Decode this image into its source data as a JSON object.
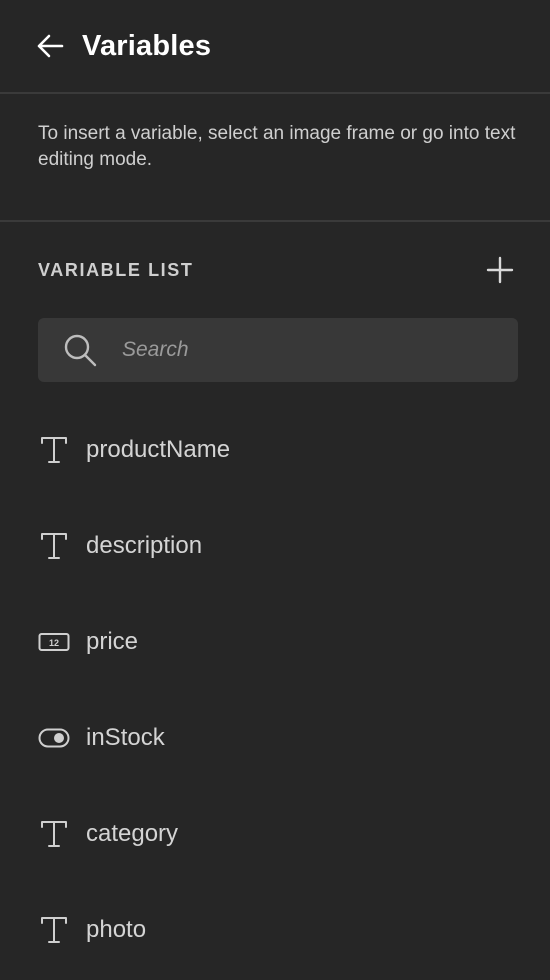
{
  "header": {
    "title": "Variables",
    "back_icon": "arrow-left-icon"
  },
  "hint": {
    "text": "To insert a variable, select an image frame or go into text editing mode."
  },
  "variable_list": {
    "title": "VARIABLE LIST",
    "add_icon": "plus-icon",
    "search": {
      "placeholder": "Search",
      "value": ""
    },
    "items": [
      {
        "label": "productName",
        "type": "text",
        "icon": "text-type-icon"
      },
      {
        "label": "description",
        "type": "text",
        "icon": "text-type-icon"
      },
      {
        "label": "price",
        "type": "number",
        "icon": "number-type-icon"
      },
      {
        "label": "inStock",
        "type": "boolean",
        "icon": "toggle-type-icon"
      },
      {
        "label": "category",
        "type": "text",
        "icon": "text-type-icon"
      },
      {
        "label": "photo",
        "type": "text",
        "icon": "text-type-icon"
      }
    ]
  },
  "colors": {
    "background": "#262626",
    "divider": "#3a3a3a",
    "search_bg": "#383838",
    "title": "#ffffff",
    "text": "#d4d4d4"
  }
}
